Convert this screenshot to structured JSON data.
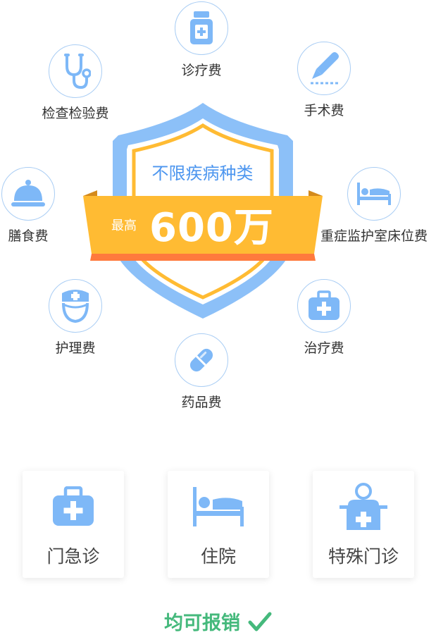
{
  "colors": {
    "icon_blue": "#7eb8f7",
    "circle_border": "#a9cdf4",
    "shield_blue": "#8cc0f8",
    "ribbon_orange": "#ffbb33",
    "footer_green": "#45b97c"
  },
  "fees": [
    {
      "label": "诊疗费",
      "icon": "medicine-bottle-icon"
    },
    {
      "label": "检查检验费",
      "icon": "stethoscope-icon"
    },
    {
      "label": "手术费",
      "icon": "scalpel-icon"
    },
    {
      "label": "膳食费",
      "icon": "food-cloche-icon"
    },
    {
      "label": "重症监护室床位费",
      "icon": "hospital-bed-icon"
    },
    {
      "label": "护理费",
      "icon": "nurse-icon"
    },
    {
      "label": "治疗费",
      "icon": "medical-kit-icon"
    },
    {
      "label": "药品费",
      "icon": "pill-capsule-icon"
    }
  ],
  "shield": {
    "title": "不限疾病种类",
    "prefix": "最高",
    "amount": "600万"
  },
  "cards": [
    {
      "label": "门急诊",
      "icon": "medical-kit-icon"
    },
    {
      "label": "住院",
      "icon": "hospital-bed-icon"
    },
    {
      "label": "特殊门诊",
      "icon": "doctor-desk-icon"
    }
  ],
  "footer": {
    "text": "均可报销",
    "icon": "checkmark-icon"
  }
}
